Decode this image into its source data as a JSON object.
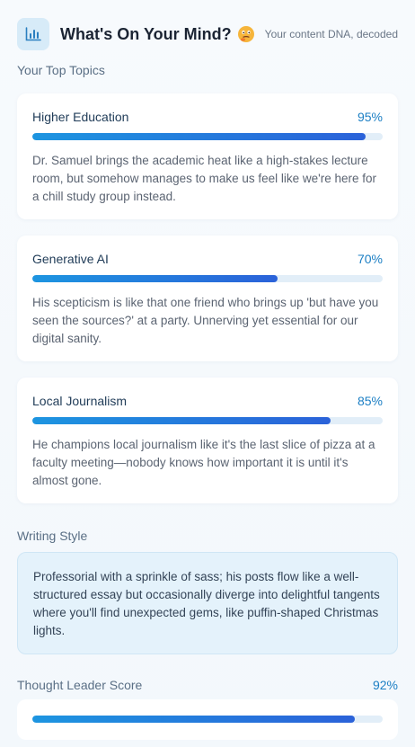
{
  "header": {
    "title": "What's On Your Mind?",
    "subtitle": "Your content DNA, decoded",
    "icon": "bar-chart-icon",
    "emoji_icon": "thinking-face-icon"
  },
  "topics_section": {
    "label": "Your Top Topics",
    "topics": [
      {
        "name": "Higher Education",
        "percent_label": "95%",
        "percent": 95,
        "description": "Dr. Samuel brings the academic heat like a high-stakes lecture room, but somehow manages to make us feel like we're here for a chill study group instead."
      },
      {
        "name": "Generative AI",
        "percent_label": "70%",
        "percent": 70,
        "description": "His scepticism is like that one friend who brings up 'but have you seen the sources?' at a party. Unnerving yet essential for our digital sanity."
      },
      {
        "name": "Local Journalism",
        "percent_label": "85%",
        "percent": 85,
        "description": "He champions local journalism like it's the last slice of pizza at a faculty meeting—nobody knows how important it is until it's almost gone."
      }
    ]
  },
  "writing_style": {
    "label": "Writing Style",
    "text": "Professorial with a sprinkle of sass; his posts flow like a well-structured essay but occasionally diverge into delightful tangents where you'll find unexpected gems, like puffin-shaped Christmas lights."
  },
  "thought_leader": {
    "label": "Thought Leader Score",
    "percent_label": "92%",
    "percent": 92
  },
  "colors": {
    "accent": "#1c7fc4",
    "bar_start": "#1d95e0",
    "bar_end": "#2b62d9",
    "track": "#e2eef8",
    "style_box": "#e4f2fb"
  }
}
